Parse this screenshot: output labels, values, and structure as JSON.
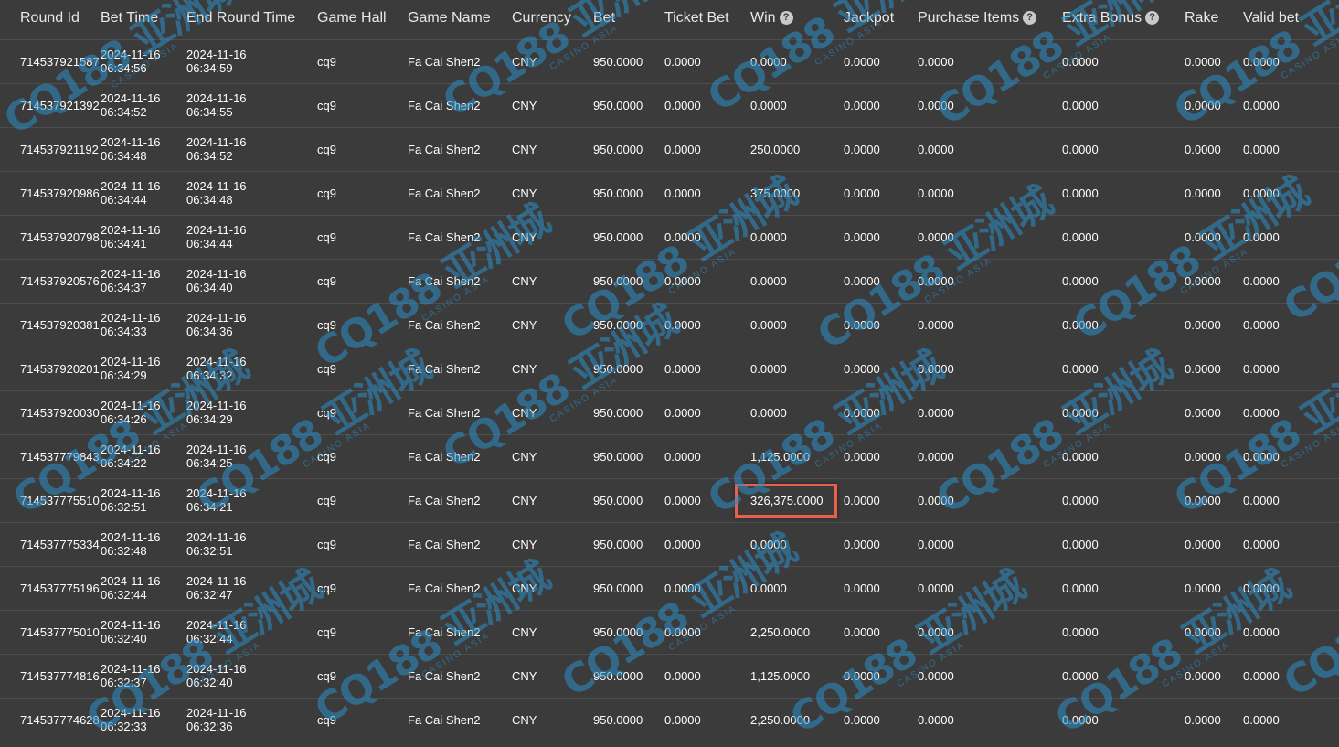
{
  "columns": [
    {
      "label": "Round Id",
      "help": false
    },
    {
      "label": "Bet Time",
      "help": false
    },
    {
      "label": "End Round Time",
      "help": false
    },
    {
      "label": "Game Hall",
      "help": false
    },
    {
      "label": "Game Name",
      "help": false
    },
    {
      "label": "Currency",
      "help": false
    },
    {
      "label": "Bet",
      "help": false
    },
    {
      "label": "Ticket Bet",
      "help": false
    },
    {
      "label": "Win",
      "help": true
    },
    {
      "label": "Jackpot",
      "help": false
    },
    {
      "label": "Purchase Items",
      "help": true
    },
    {
      "label": "Extra Bonus",
      "help": true
    },
    {
      "label": "Rake",
      "help": false
    },
    {
      "label": "Valid bet",
      "help": false
    }
  ],
  "help_icon_glyph": "?",
  "rows": [
    {
      "round_id": "714537921587",
      "bet_date": "2024-11-16",
      "bet_time": "06:34:56",
      "end_date": "2024-11-16",
      "end_time": "06:34:59",
      "hall": "cq9",
      "game": "Fa Cai Shen2",
      "currency": "CNY",
      "bet": "950.0000",
      "ticket_bet": "0.0000",
      "win": "0.0000",
      "jackpot": "0.0000",
      "purchase": "0.0000",
      "extra_bonus": "0.0000",
      "rake": "0.0000",
      "valid_bet": "0.0000"
    },
    {
      "round_id": "714537921392",
      "bet_date": "2024-11-16",
      "bet_time": "06:34:52",
      "end_date": "2024-11-16",
      "end_time": "06:34:55",
      "hall": "cq9",
      "game": "Fa Cai Shen2",
      "currency": "CNY",
      "bet": "950.0000",
      "ticket_bet": "0.0000",
      "win": "0.0000",
      "jackpot": "0.0000",
      "purchase": "0.0000",
      "extra_bonus": "0.0000",
      "rake": "0.0000",
      "valid_bet": "0.0000"
    },
    {
      "round_id": "714537921192",
      "bet_date": "2024-11-16",
      "bet_time": "06:34:48",
      "end_date": "2024-11-16",
      "end_time": "06:34:52",
      "hall": "cq9",
      "game": "Fa Cai Shen2",
      "currency": "CNY",
      "bet": "950.0000",
      "ticket_bet": "0.0000",
      "win": "250.0000",
      "jackpot": "0.0000",
      "purchase": "0.0000",
      "extra_bonus": "0.0000",
      "rake": "0.0000",
      "valid_bet": "0.0000"
    },
    {
      "round_id": "714537920986",
      "bet_date": "2024-11-16",
      "bet_time": "06:34:44",
      "end_date": "2024-11-16",
      "end_time": "06:34:48",
      "hall": "cq9",
      "game": "Fa Cai Shen2",
      "currency": "CNY",
      "bet": "950.0000",
      "ticket_bet": "0.0000",
      "win": "375.0000",
      "jackpot": "0.0000",
      "purchase": "0.0000",
      "extra_bonus": "0.0000",
      "rake": "0.0000",
      "valid_bet": "0.0000"
    },
    {
      "round_id": "714537920798",
      "bet_date": "2024-11-16",
      "bet_time": "06:34:41",
      "end_date": "2024-11-16",
      "end_time": "06:34:44",
      "hall": "cq9",
      "game": "Fa Cai Shen2",
      "currency": "CNY",
      "bet": "950.0000",
      "ticket_bet": "0.0000",
      "win": "0.0000",
      "jackpot": "0.0000",
      "purchase": "0.0000",
      "extra_bonus": "0.0000",
      "rake": "0.0000",
      "valid_bet": "0.0000"
    },
    {
      "round_id": "714537920576",
      "bet_date": "2024-11-16",
      "bet_time": "06:34:37",
      "end_date": "2024-11-16",
      "end_time": "06:34:40",
      "hall": "cq9",
      "game": "Fa Cai Shen2",
      "currency": "CNY",
      "bet": "950.0000",
      "ticket_bet": "0.0000",
      "win": "0.0000",
      "jackpot": "0.0000",
      "purchase": "0.0000",
      "extra_bonus": "0.0000",
      "rake": "0.0000",
      "valid_bet": "0.0000"
    },
    {
      "round_id": "714537920381",
      "bet_date": "2024-11-16",
      "bet_time": "06:34:33",
      "end_date": "2024-11-16",
      "end_time": "06:34:36",
      "hall": "cq9",
      "game": "Fa Cai Shen2",
      "currency": "CNY",
      "bet": "950.0000",
      "ticket_bet": "0.0000",
      "win": "0.0000",
      "jackpot": "0.0000",
      "purchase": "0.0000",
      "extra_bonus": "0.0000",
      "rake": "0.0000",
      "valid_bet": "0.0000"
    },
    {
      "round_id": "714537920201",
      "bet_date": "2024-11-16",
      "bet_time": "06:34:29",
      "end_date": "2024-11-16",
      "end_time": "06:34:32",
      "hall": "cq9",
      "game": "Fa Cai Shen2",
      "currency": "CNY",
      "bet": "950.0000",
      "ticket_bet": "0.0000",
      "win": "0.0000",
      "jackpot": "0.0000",
      "purchase": "0.0000",
      "extra_bonus": "0.0000",
      "rake": "0.0000",
      "valid_bet": "0.0000"
    },
    {
      "round_id": "714537920030",
      "bet_date": "2024-11-16",
      "bet_time": "06:34:26",
      "end_date": "2024-11-16",
      "end_time": "06:34:29",
      "hall": "cq9",
      "game": "Fa Cai Shen2",
      "currency": "CNY",
      "bet": "950.0000",
      "ticket_bet": "0.0000",
      "win": "0.0000",
      "jackpot": "0.0000",
      "purchase": "0.0000",
      "extra_bonus": "0.0000",
      "rake": "0.0000",
      "valid_bet": "0.0000"
    },
    {
      "round_id": "714537779843",
      "bet_date": "2024-11-16",
      "bet_time": "06:34:22",
      "end_date": "2024-11-16",
      "end_time": "06:34:25",
      "hall": "cq9",
      "game": "Fa Cai Shen2",
      "currency": "CNY",
      "bet": "950.0000",
      "ticket_bet": "0.0000",
      "win": "1,125.0000",
      "jackpot": "0.0000",
      "purchase": "0.0000",
      "extra_bonus": "0.0000",
      "rake": "0.0000",
      "valid_bet": "0.0000"
    },
    {
      "round_id": "714537775510",
      "bet_date": "2024-11-16",
      "bet_time": "06:32:51",
      "end_date": "2024-11-16",
      "end_time": "06:34:21",
      "hall": "cq9",
      "game": "Fa Cai Shen2",
      "currency": "CNY",
      "bet": "950.0000",
      "ticket_bet": "0.0000",
      "win": "326,375.0000",
      "win_highlighted": true,
      "jackpot": "0.0000",
      "purchase": "0.0000",
      "extra_bonus": "0.0000",
      "rake": "0.0000",
      "valid_bet": "0.0000"
    },
    {
      "round_id": "714537775334",
      "bet_date": "2024-11-16",
      "bet_time": "06:32:48",
      "end_date": "2024-11-16",
      "end_time": "06:32:51",
      "hall": "cq9",
      "game": "Fa Cai Shen2",
      "currency": "CNY",
      "bet": "950.0000",
      "ticket_bet": "0.0000",
      "win": "0.0000",
      "jackpot": "0.0000",
      "purchase": "0.0000",
      "extra_bonus": "0.0000",
      "rake": "0.0000",
      "valid_bet": "0.0000"
    },
    {
      "round_id": "714537775196",
      "bet_date": "2024-11-16",
      "bet_time": "06:32:44",
      "end_date": "2024-11-16",
      "end_time": "06:32:47",
      "hall": "cq9",
      "game": "Fa Cai Shen2",
      "currency": "CNY",
      "bet": "950.0000",
      "ticket_bet": "0.0000",
      "win": "0.0000",
      "jackpot": "0.0000",
      "purchase": "0.0000",
      "extra_bonus": "0.0000",
      "rake": "0.0000",
      "valid_bet": "0.0000"
    },
    {
      "round_id": "714537775010",
      "bet_date": "2024-11-16",
      "bet_time": "06:32:40",
      "end_date": "2024-11-16",
      "end_time": "06:32:44",
      "hall": "cq9",
      "game": "Fa Cai Shen2",
      "currency": "CNY",
      "bet": "950.0000",
      "ticket_bet": "0.0000",
      "win": "2,250.0000",
      "jackpot": "0.0000",
      "purchase": "0.0000",
      "extra_bonus": "0.0000",
      "rake": "0.0000",
      "valid_bet": "0.0000"
    },
    {
      "round_id": "714537774816",
      "bet_date": "2024-11-16",
      "bet_time": "06:32:37",
      "end_date": "2024-11-16",
      "end_time": "06:32:40",
      "hall": "cq9",
      "game": "Fa Cai Shen2",
      "currency": "CNY",
      "bet": "950.0000",
      "ticket_bet": "0.0000",
      "win": "1,125.0000",
      "jackpot": "0.0000",
      "purchase": "0.0000",
      "extra_bonus": "0.0000",
      "rake": "0.0000",
      "valid_bet": "0.0000"
    },
    {
      "round_id": "714537774628",
      "bet_date": "2024-11-16",
      "bet_time": "06:32:33",
      "end_date": "2024-11-16",
      "end_time": "06:32:36",
      "hall": "cq9",
      "game": "Fa Cai Shen2",
      "currency": "CNY",
      "bet": "950.0000",
      "ticket_bet": "0.0000",
      "win": "2,250.0000",
      "jackpot": "0.0000",
      "purchase": "0.0000",
      "extra_bonus": "0.0000",
      "rake": "0.0000",
      "valid_bet": "0.0000"
    }
  ],
  "watermark": {
    "main": "CQ188 亚洲城",
    "sub": "CASINO ASIA"
  },
  "colors": {
    "background": "#3b3b3b",
    "highlight_border": "#e8604d",
    "watermark": "#2c8fc9"
  }
}
